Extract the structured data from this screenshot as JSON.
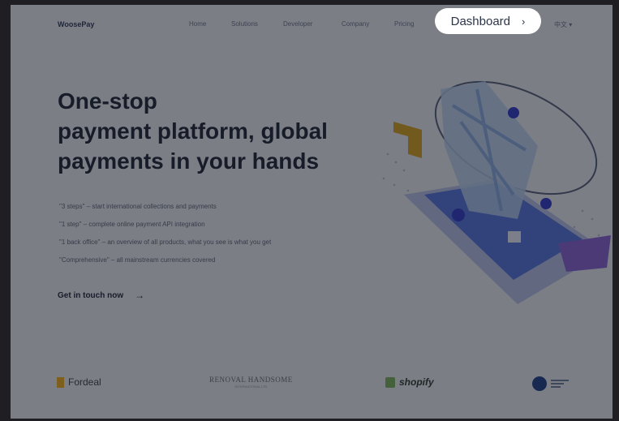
{
  "header": {
    "logo": "WoosePay",
    "nav": [
      "Home",
      "Solutions",
      "Developer",
      "Company",
      "Pricing"
    ],
    "dashboard_label": "Dashboard",
    "language": "中文 ▾"
  },
  "hero": {
    "title_lines": [
      "One-stop",
      "payment platform, global",
      "payments in your hands"
    ],
    "features": [
      "\"3 steps\" – start international collections and payments",
      "\"1 step\" – complete online payment API integration",
      "\"1 back office\" – an overview of all products, what you see is what you get",
      "\"Comprehensive\" – all mainstream currencies covered"
    ],
    "cta_label": "Get in touch now",
    "cta_arrow": "→"
  },
  "partners": {
    "fordeal": "Fordeal",
    "rh_top": "RENOVAL HANDSOME",
    "rh_sub": "INTERNATIONAL LTD",
    "shopify": "shopify"
  },
  "colors": {
    "accent": "#3a5ad8",
    "dim": "rgba(20,22,30,0.52)"
  },
  "icons": {
    "dashboard_chevron": "chevron-right-icon",
    "cta_arrow": "arrow-right-icon"
  }
}
